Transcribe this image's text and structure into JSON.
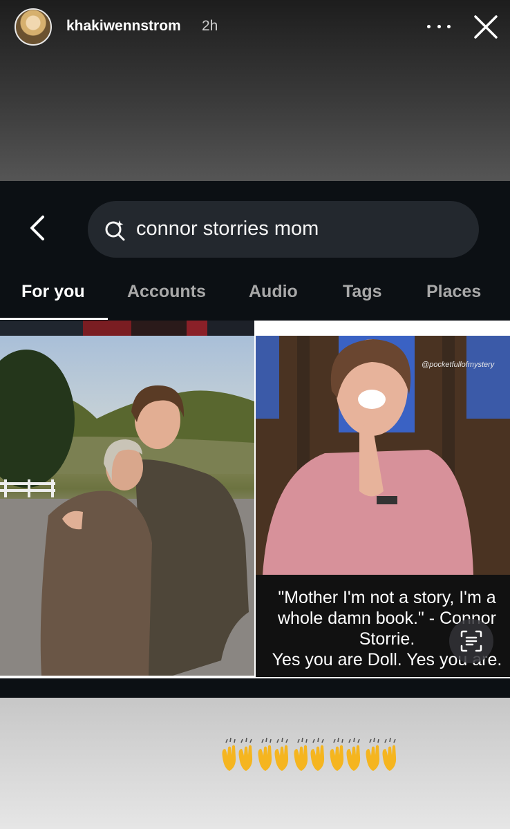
{
  "story": {
    "username": "khakiwennstrom",
    "time": "2h",
    "more_icon": "more-horizontal-icon",
    "close_icon": "close-icon"
  },
  "search": {
    "back_icon": "chevron-left-icon",
    "query": "connor storries mom",
    "search_icon": "search-sparkle-icon"
  },
  "tabs": [
    {
      "label": "For you",
      "active": true
    },
    {
      "label": "Accounts",
      "active": false
    },
    {
      "label": "Audio",
      "active": false
    },
    {
      "label": "Tags",
      "active": false
    },
    {
      "label": "Places",
      "active": false
    }
  ],
  "results": {
    "right_post": {
      "watermark": "@pocketfullofmystery",
      "quote": "\"Mother I'm not a story, I'm a\nwhole damn book.\" - Connor\nStorrie.\nYes you are Doll. Yes you are."
    }
  },
  "overlay": {
    "text_scan_icon": "text-scan-icon"
  },
  "caption": {
    "emoji": "🙌🙌🙌🙌🙌",
    "emoji_count": 5
  },
  "colors": {
    "app_background": "#0c1014",
    "search_background": "#23282e",
    "tab_inactive": "#a8a8a8",
    "tab_active": "#ffffff"
  }
}
